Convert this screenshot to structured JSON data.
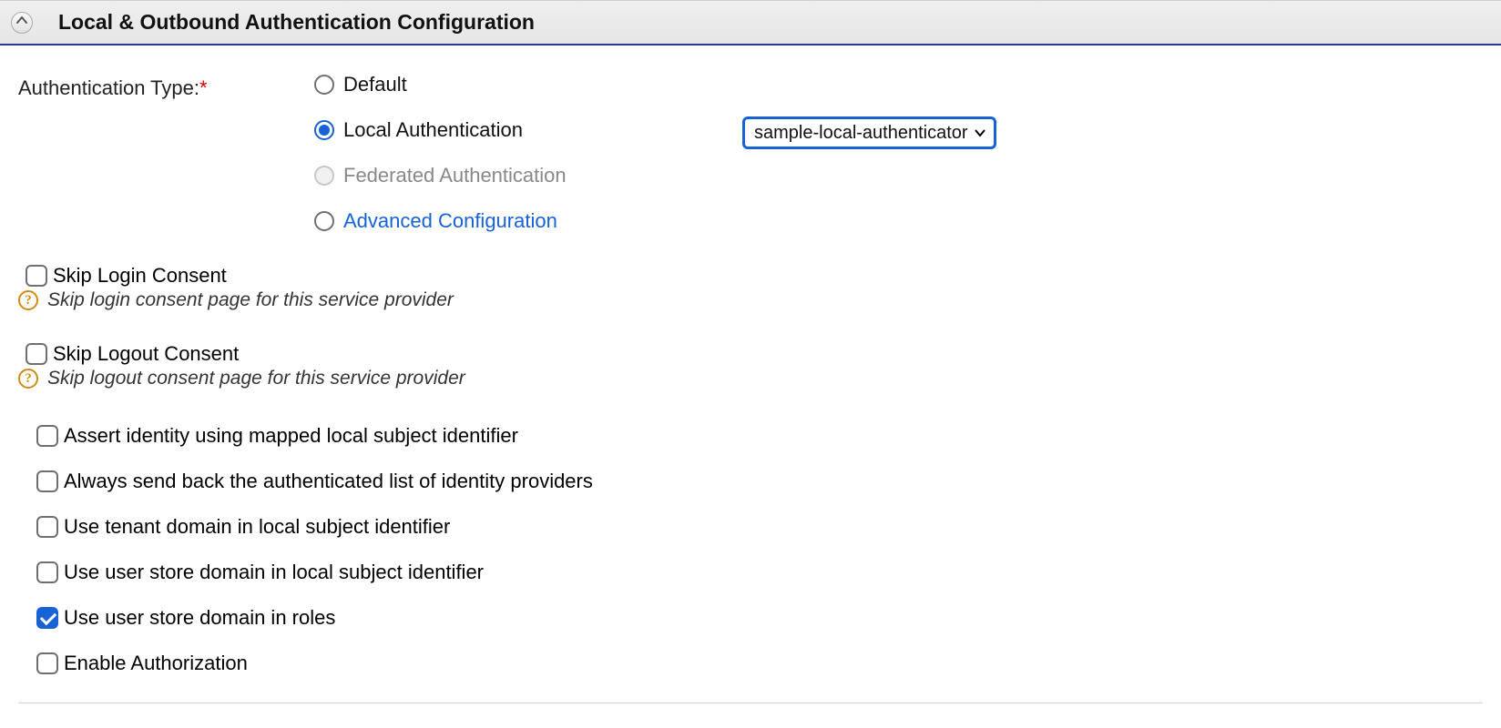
{
  "header": {
    "title": "Local & Outbound Authentication Configuration"
  },
  "auth": {
    "label": "Authentication Type:",
    "required_mark": "*",
    "options": {
      "default": "Default",
      "local": "Local Authentication",
      "federated": "Federated Authentication",
      "advanced": "Advanced Configuration"
    },
    "selected": "local",
    "federated_disabled": true,
    "local_authenticator_selected": "sample-local-authenticator",
    "local_authenticator_options": [
      "sample-local-authenticator"
    ]
  },
  "consent": {
    "skip_login": {
      "label": "Skip Login Consent",
      "checked": false,
      "help": "Skip login consent page for this service provider"
    },
    "skip_logout": {
      "label": "Skip Logout Consent",
      "checked": false,
      "help": "Skip logout consent page for this service provider"
    }
  },
  "options": {
    "assert_identity": {
      "label": "Assert identity using mapped local subject identifier",
      "checked": false
    },
    "always_send_idp_list": {
      "label": "Always send back the authenticated list of identity providers",
      "checked": false
    },
    "use_tenant_domain": {
      "label": "Use tenant domain in local subject identifier",
      "checked": false
    },
    "use_user_store_domain_subject": {
      "label": "Use user store domain in local subject identifier",
      "checked": false
    },
    "use_user_store_domain_roles": {
      "label": "Use user store domain in roles",
      "checked": true
    },
    "enable_authorization": {
      "label": "Enable Authorization",
      "checked": false
    }
  }
}
